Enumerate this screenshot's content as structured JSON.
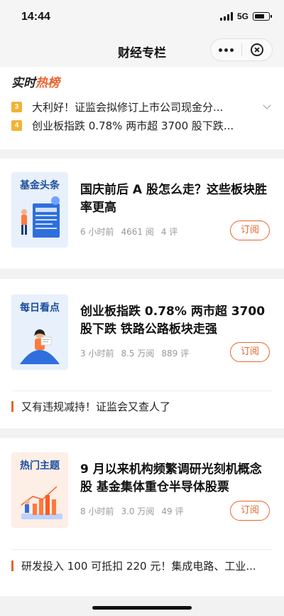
{
  "status": {
    "time": "14:44",
    "network": "5G"
  },
  "navbar": {
    "title": "财经专栏"
  },
  "hot": {
    "logo_a": "实时",
    "logo_b": "热榜",
    "items": [
      {
        "rank": "3",
        "text": "大利好！证监会拟修订上市公司现金分..."
      },
      {
        "rank": "4",
        "text": "创业板指跌 0.78% 两市超 3700 股下跌..."
      }
    ]
  },
  "articles": [
    {
      "tag": "基金头条",
      "title": "国庆前后 A 股怎么走？这些板块胜率更高",
      "time": "6 小时前",
      "reads": "4661 阅",
      "comments": "4 评",
      "subscribe": "订阅"
    },
    {
      "tag": "每日看点",
      "title": "创业板指跌 0.78% 两市超 3700 股下跌 铁路公路板块走强",
      "time": "3 小时前",
      "reads": "8.5 万阅",
      "comments": "889 评",
      "subscribe": "订阅",
      "related": "又有违规减持！证监会又查人了"
    },
    {
      "tag": "热门主题",
      "title": "9 月以来机构频繁调研光刻机概念股 基金集体重仓半导体股票",
      "time": "8 小时前",
      "reads": "3.0 万阅",
      "comments": "49 评",
      "subscribe": "订阅",
      "related": "研发投入 100 可抵扣 220 元！集成电路、工业..."
    }
  ],
  "colors": {
    "accent": "#e8652c",
    "rank_badge": "#f2b235",
    "tag_text": "#1b4d9e"
  }
}
